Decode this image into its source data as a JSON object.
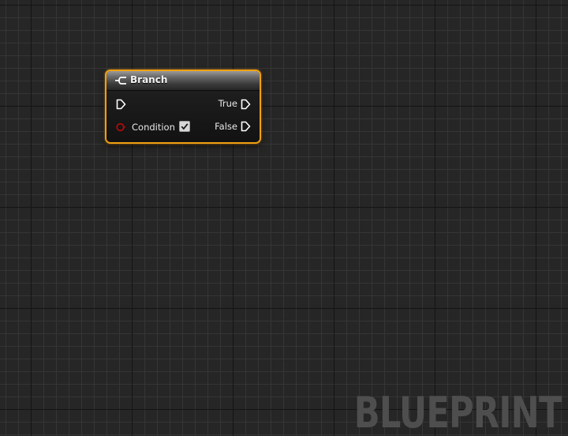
{
  "node": {
    "title": "Branch",
    "header_icon": "branch-icon",
    "border_color": "#f0a010",
    "pins": {
      "exec_in": {
        "icon": "exec-arrow-icon",
        "label": ""
      },
      "condition": {
        "icon": "bool-pin-icon",
        "label": "Condition",
        "color": "#b80a0a",
        "checked": true
      },
      "true_out": {
        "icon": "exec-arrow-icon",
        "label": "True"
      },
      "false_out": {
        "icon": "exec-arrow-icon",
        "label": "False"
      }
    }
  },
  "watermark": "BLUEPRINT"
}
